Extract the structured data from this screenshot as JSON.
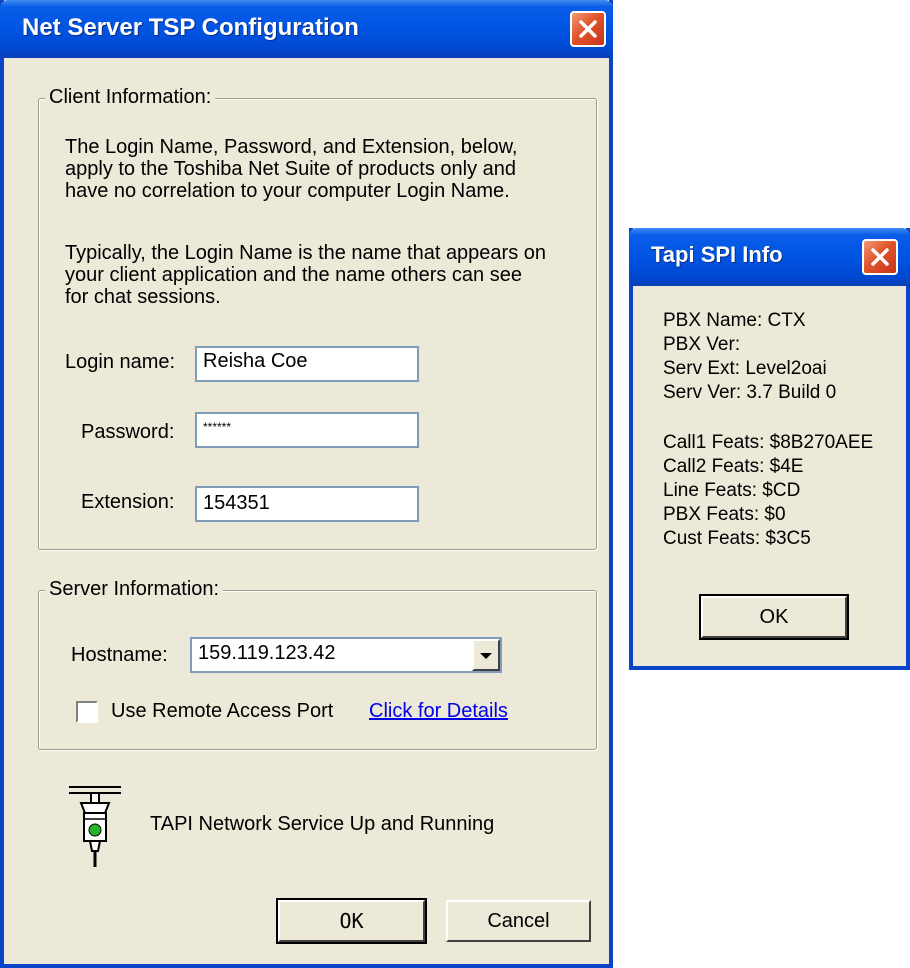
{
  "main_dialog": {
    "title": "Net Server TSP Configuration",
    "client_group": {
      "legend": "Client Information:",
      "para1": [
        "The Login Name, Password, and Extension, below,",
        "apply to the Toshiba Net Suite of products only and",
        "have no correlation to your computer Login Name."
      ],
      "para2": [
        "Typically, the Login Name is the name that appears on",
        "your client application and the name others can see",
        "for chat sessions."
      ],
      "login_label": "Login name:",
      "login_value": "Reisha Coe",
      "password_label": "Password:",
      "password_value": "******",
      "extension_label": "Extension:",
      "extension_value": "154351"
    },
    "server_group": {
      "legend": "Server Information:",
      "hostname_label": "Hostname:",
      "hostname_value": "159.119.123.42",
      "remote_access_label": "Use Remote Access Port",
      "remote_access_checked": false,
      "details_link": "Click for Details"
    },
    "status_text": "TAPI Network Service Up and Running",
    "ok_label": "OK",
    "cancel_label": "Cancel"
  },
  "info_dialog": {
    "title": "Tapi SPI Info",
    "lines_top": [
      "PBX Name: CTX",
      "PBX Ver:",
      "Serv Ext: Level2oai",
      "Serv Ver: 3.7 Build 0"
    ],
    "lines_bottom": [
      "Call1 Feats: $8B270AEE",
      "Call2 Feats: $4E",
      "Line Feats: $CD",
      "PBX Feats: $0",
      "Cust Feats: $3C5"
    ],
    "ok_label": "OK"
  },
  "colors": {
    "titlebar": "#0054e3",
    "window_bg": "#ece9d8",
    "close_button": "#e0542a",
    "link": "#0000ee"
  }
}
